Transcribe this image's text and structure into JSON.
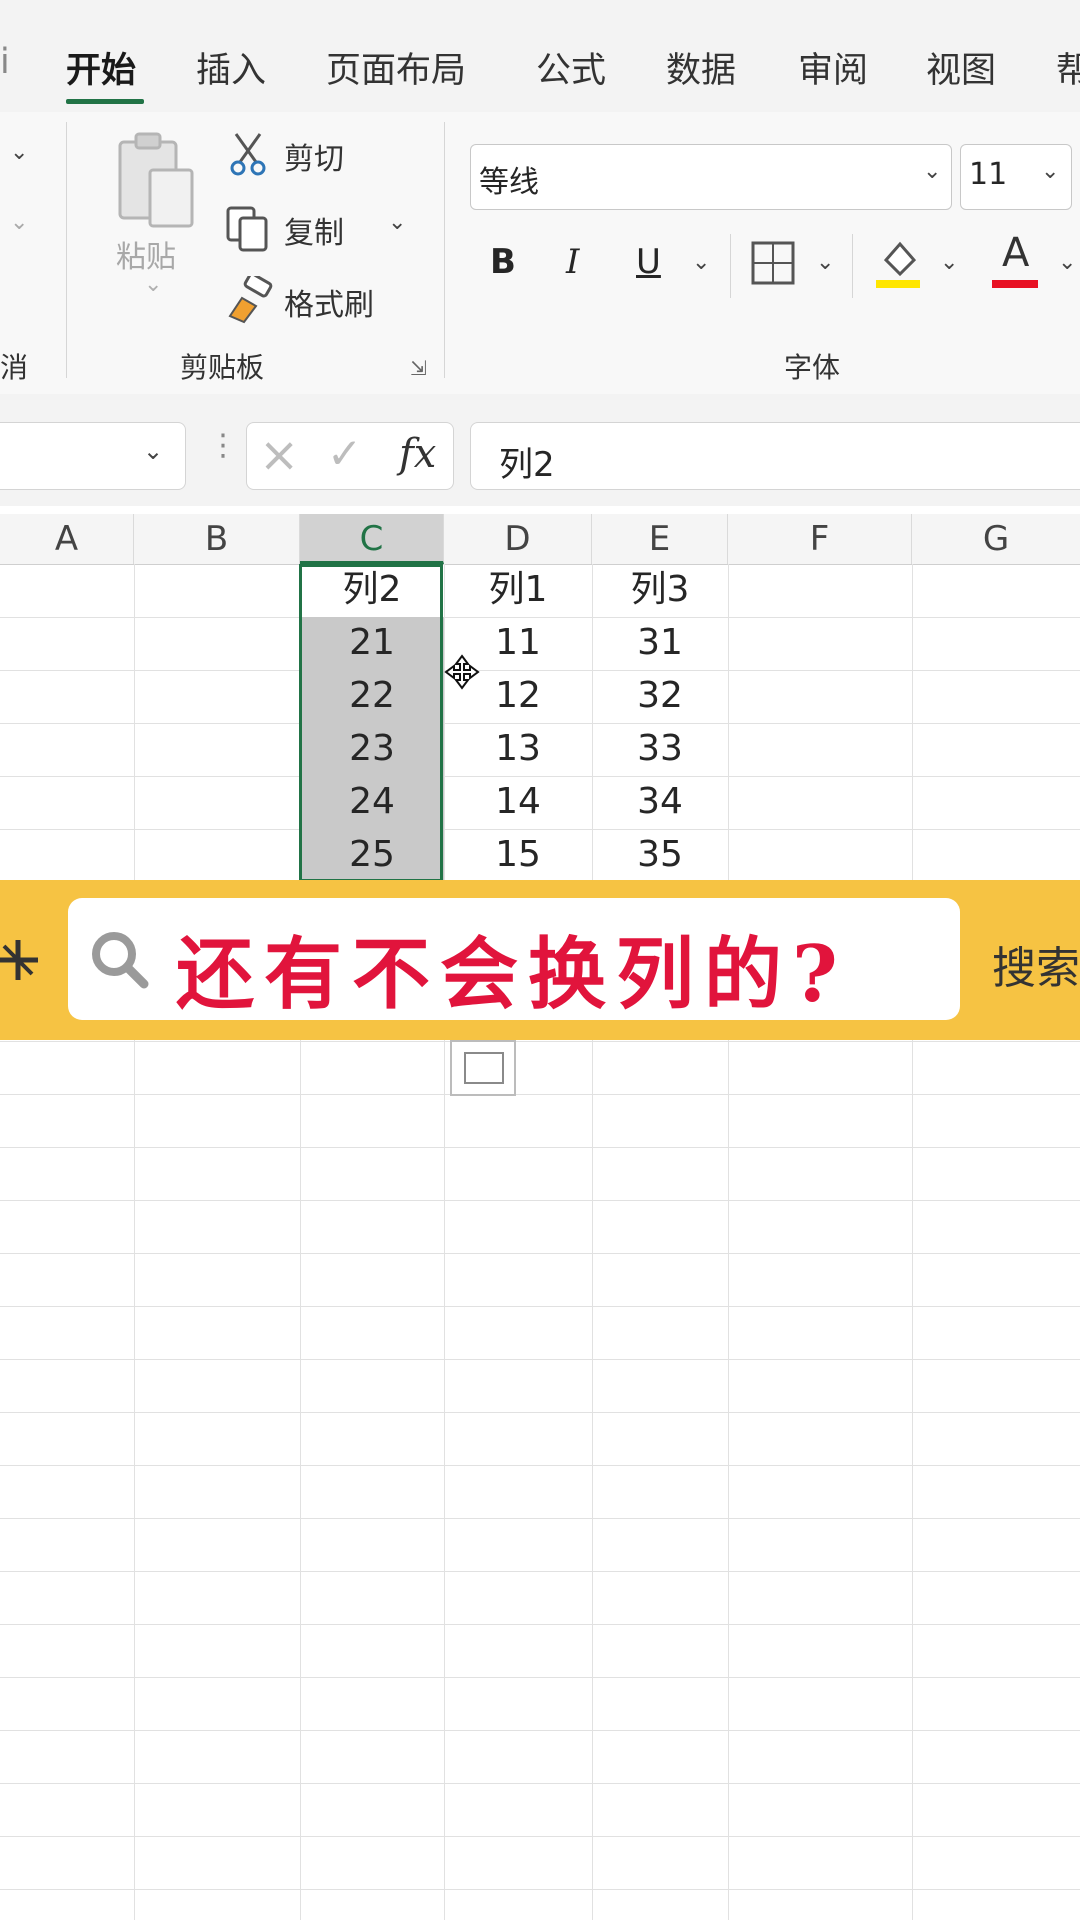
{
  "ribbon_tabs": {
    "left_partial": "…",
    "items": [
      "开始",
      "插入",
      "页面布局",
      "公式",
      "数据",
      "审阅",
      "视图",
      "帮"
    ],
    "active": "开始"
  },
  "clipboard": {
    "undo_partial_label": "消",
    "paste_label": "粘贴",
    "cut_label": "剪切",
    "copy_label": "复制",
    "format_painter_label": "格式刷",
    "group_label": "剪贴板"
  },
  "font": {
    "font_name": "等线",
    "font_size": "11",
    "bold": "B",
    "italic": "I",
    "underline": "U",
    "font_color_letter": "A",
    "group_label": "字体",
    "fill_color": "#ffe600",
    "font_color": "#e81123"
  },
  "formula_bar": {
    "cancel_glyph": "×",
    "enter_glyph": "✓",
    "fx_label": "fx",
    "content": "列2"
  },
  "columns": [
    "A",
    "B",
    "C",
    "D",
    "E",
    "F",
    "G"
  ],
  "selected_column": "C",
  "table": {
    "C": [
      "列2",
      "21",
      "22",
      "23",
      "24",
      "25"
    ],
    "D": [
      "列1",
      "11",
      "12",
      "13",
      "14",
      "15"
    ],
    "E": [
      "列3",
      "31",
      "32",
      "33",
      "34",
      "35"
    ]
  },
  "banner": {
    "text": "还有不会换列的?",
    "right_partial": "搜索"
  },
  "colors": {
    "accent_green": "#217346",
    "banner_yellow": "#f6c343",
    "banner_text_red": "#e1143c"
  }
}
